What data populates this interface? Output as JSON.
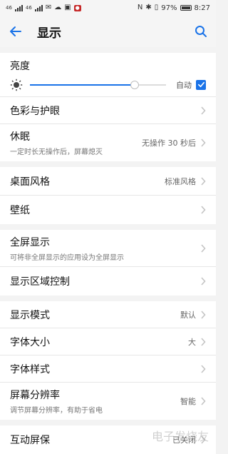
{
  "status_bar": {
    "signal_1_label": "46",
    "signal_2_label": "46",
    "right_percent": "97%",
    "time": "8:27"
  },
  "header": {
    "title": "显示"
  },
  "brightness": {
    "label": "亮度",
    "auto_label": "自动",
    "level_percent": 77,
    "auto_checked": true
  },
  "sections": [
    {
      "items": [
        {
          "label": "色彩与护眼",
          "value": "",
          "sub": ""
        },
        {
          "label": "休眠",
          "value": "无操作 30 秒后",
          "sub": "一定时长无操作后，屏幕熄灭"
        }
      ]
    },
    {
      "items": [
        {
          "label": "桌面风格",
          "value": "标准风格",
          "sub": ""
        },
        {
          "label": "壁纸",
          "value": "",
          "sub": ""
        }
      ]
    },
    {
      "items": [
        {
          "label": "全屏显示",
          "value": "",
          "sub": "可将非全屏显示的应用设为全屏显示"
        },
        {
          "label": "显示区域控制",
          "value": "",
          "sub": ""
        }
      ]
    },
    {
      "items": [
        {
          "label": "显示模式",
          "value": "默认",
          "sub": ""
        },
        {
          "label": "字体大小",
          "value": "大",
          "sub": ""
        },
        {
          "label": "字体样式",
          "value": "",
          "sub": ""
        },
        {
          "label": "屏幕分辨率",
          "value": "智能",
          "sub": "调节屏幕分辨率，有助于省电"
        }
      ]
    },
    {
      "items": [
        {
          "label": "互动屏保",
          "value": "已关闭",
          "sub": ""
        }
      ]
    }
  ],
  "watermark": "电子发烧友"
}
